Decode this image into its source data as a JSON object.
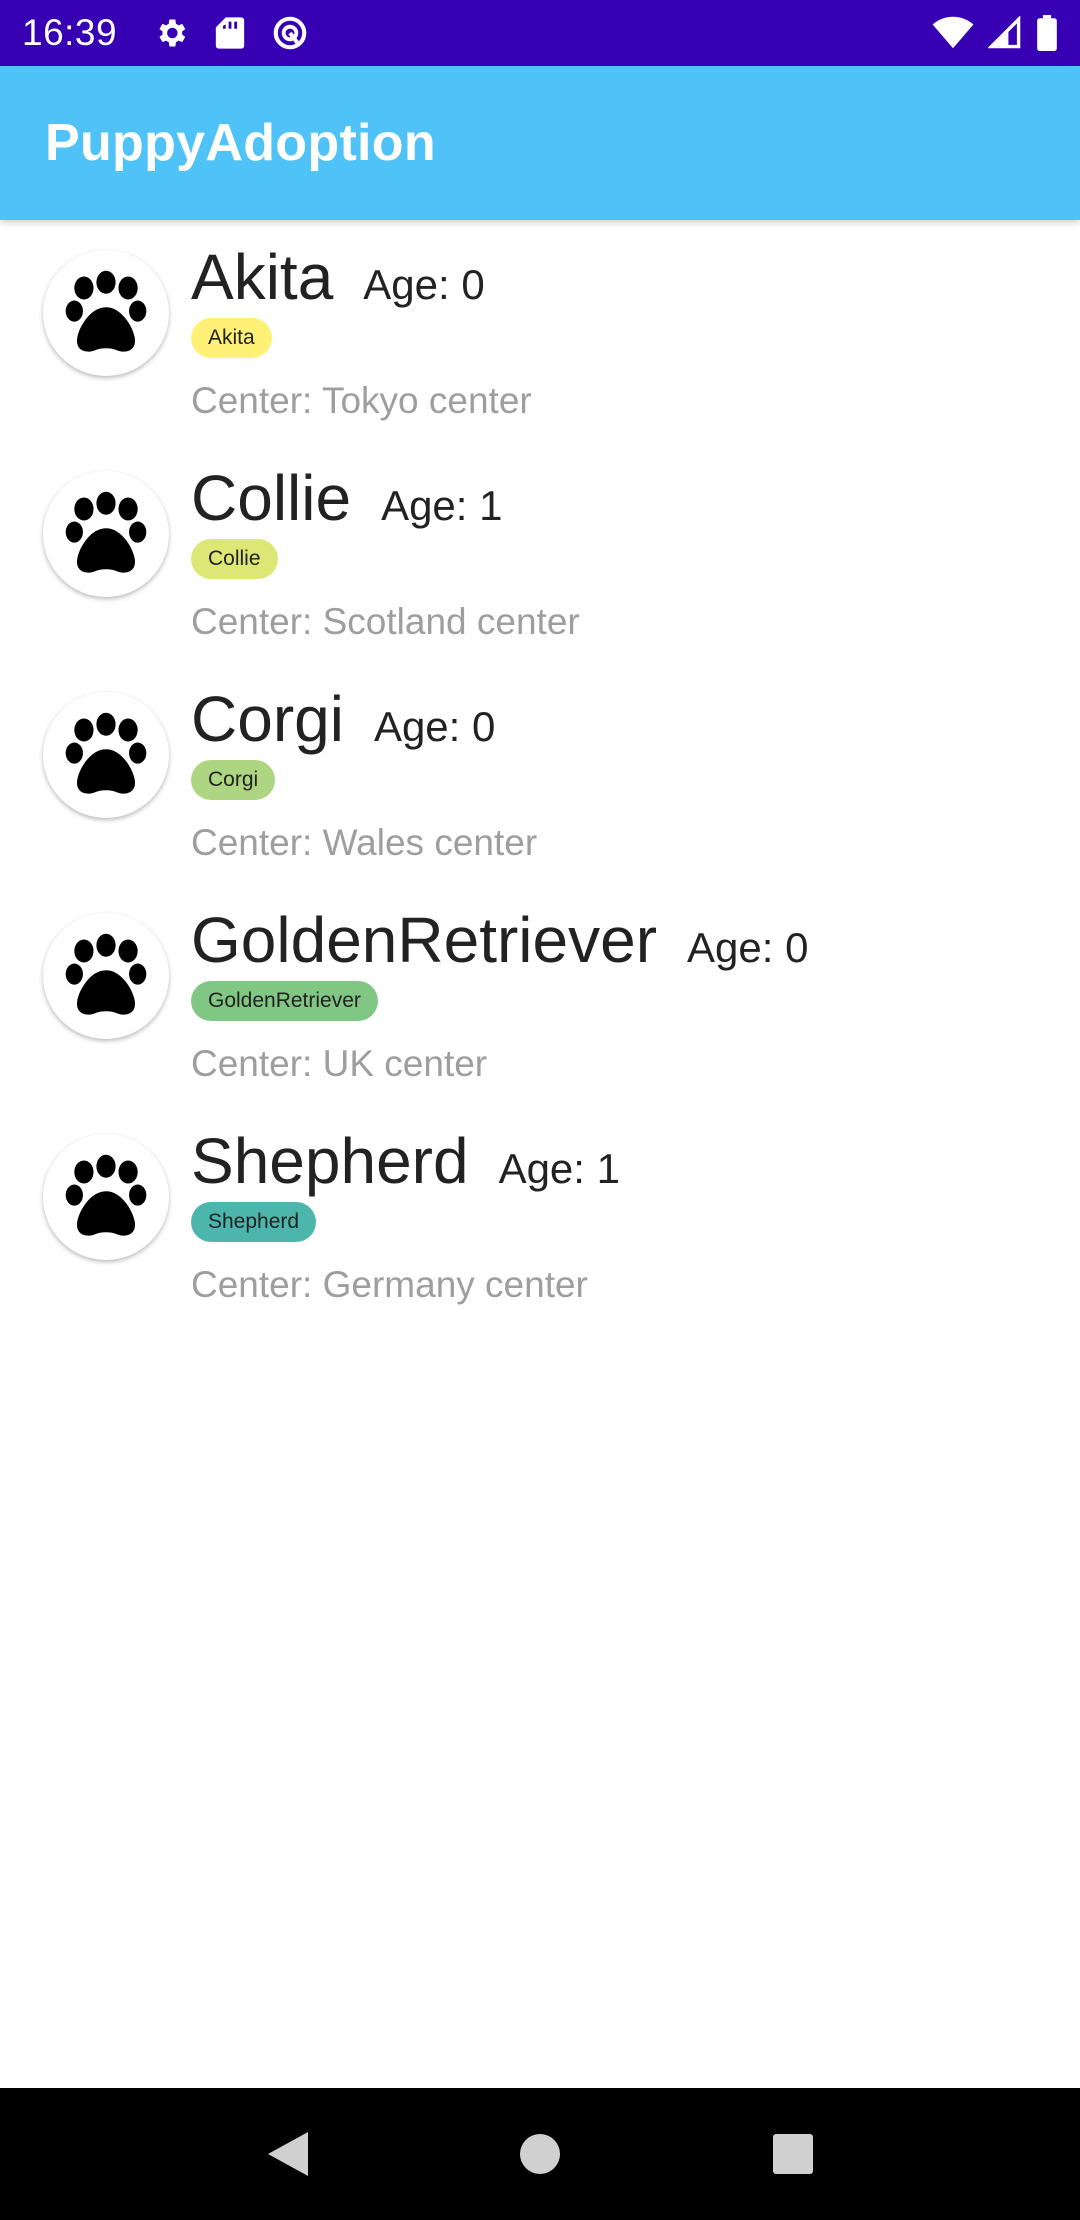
{
  "status_bar": {
    "time": "16:39",
    "left_icons": [
      "settings-icon",
      "sd-card-icon",
      "data-saver-icon"
    ],
    "right_icons": [
      "wifi-icon",
      "cell-signal-icon",
      "battery-icon"
    ]
  },
  "app_bar": {
    "title": "PuppyAdoption"
  },
  "puppies": [
    {
      "name": "Akita",
      "age": "Age: 0",
      "breed": "Akita",
      "center": "Center: Tokyo center",
      "chip_color": "#FFF176",
      "icon": "paw-icon"
    },
    {
      "name": "Collie",
      "age": "Age: 1",
      "breed": "Collie",
      "center": "Center: Scotland center",
      "chip_color": "#DCE775",
      "icon": "paw-icon"
    },
    {
      "name": "Corgi",
      "age": "Age: 0",
      "breed": "Corgi",
      "center": "Center: Wales center",
      "chip_color": "#AED581",
      "icon": "paw-icon"
    },
    {
      "name": "GoldenRetriever",
      "age": "Age: 0",
      "breed": "GoldenRetriever",
      "center": "Center: UK center",
      "chip_color": "#81C784",
      "icon": "paw-icon"
    },
    {
      "name": "Shepherd",
      "age": "Age: 1",
      "breed": "Shepherd",
      "center": "Center: Germany center",
      "chip_color": "#4DB6AC",
      "icon": "paw-icon"
    }
  ],
  "nav_bar": {
    "buttons": [
      "back-icon",
      "home-icon",
      "recents-icon"
    ]
  },
  "colors": {
    "status_bar": "#3700B3",
    "app_bar": "#4FC3F7",
    "nav_bar": "#000000"
  }
}
